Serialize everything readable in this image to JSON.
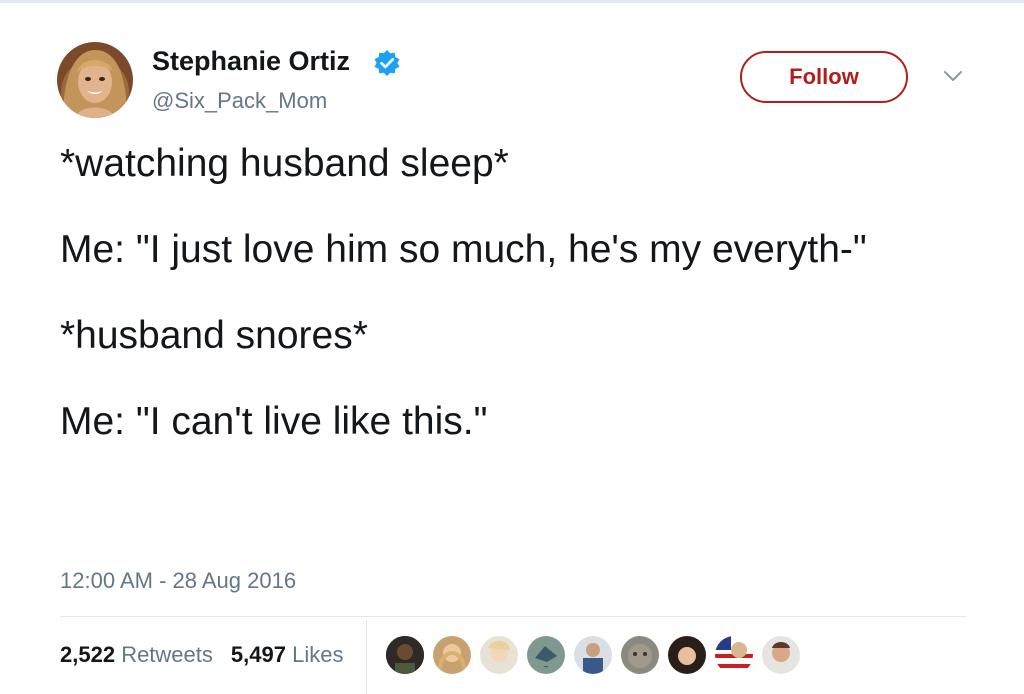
{
  "author": {
    "name": "Stephanie Ortiz",
    "handle": "@Six_Pack_Mom",
    "verified_icon": "verified-badge-icon",
    "avatar": "profile-photo"
  },
  "follow_label": "Follow",
  "menu_icon": "chevron-down-icon",
  "tweet": {
    "lines": [
      "*watching husband sleep*",
      "Me: \"I just love him so much, he's my everyth-\"",
      "*husband snores*",
      "Me: \"I can't live like this.\""
    ]
  },
  "timestamp": "12:00 AM - 28 Aug 2016",
  "stats": {
    "retweets_count": "2,522",
    "retweets_label": "Retweets",
    "likes_count": "5,497",
    "likes_label": "Likes"
  },
  "colors": {
    "follow_accent": "#b01e1e",
    "verified_blue": "#1da1f2",
    "secondary_text": "#657786"
  }
}
